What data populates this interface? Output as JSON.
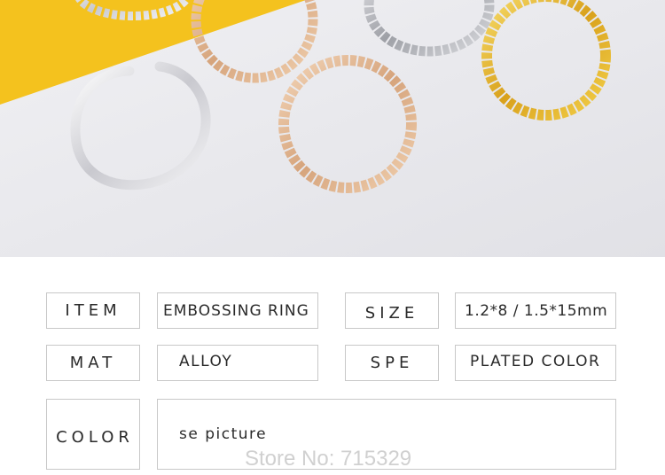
{
  "product_photo": {
    "description_icon": "metal-rings-photo",
    "colors": {
      "background": "#eaeaee",
      "yellow_card": "#f4c21e",
      "silver": "#d8d8dc",
      "rose_gold": "#e2b892",
      "gold": "#e7b832"
    }
  },
  "specs": {
    "item_label": "ITEM",
    "item_value": "EMBOSSING RING",
    "size_label": "SIZE",
    "size_value": "1.2*8 / 1.5*15mm",
    "material_label": "MAT",
    "material_value": "ALLOY",
    "spec_label": "SPE",
    "spec_value": "PLATED COLOR",
    "color_label": "COLOR",
    "color_value": "se picture"
  },
  "watermark": "Store No: 715329"
}
